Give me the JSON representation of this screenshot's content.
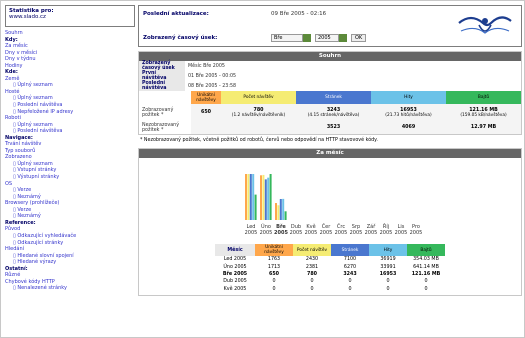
{
  "stats_box": {
    "title": "Statistika pro:",
    "site": "www.slado.cz"
  },
  "sidebar": {
    "items": [
      {
        "type": "lnk",
        "text": "Souhrn"
      },
      {
        "type": "hd",
        "text": "Kdy:"
      },
      {
        "type": "lnk",
        "text": "Za měsíc"
      },
      {
        "type": "lnk",
        "text": "Dny v měsíci"
      },
      {
        "type": "lnk",
        "text": "Dny v týdnu"
      },
      {
        "type": "lnk",
        "text": "Hodiny"
      },
      {
        "type": "hd",
        "text": "Kde:"
      },
      {
        "type": "lnk",
        "text": "Země"
      },
      {
        "type": "sub",
        "text": "▯ Úplný seznam"
      },
      {
        "type": "lnk",
        "text": "Hosté"
      },
      {
        "type": "sub",
        "text": "▯ Úplný seznam"
      },
      {
        "type": "sub",
        "text": "▯ Poslední návštěva"
      },
      {
        "type": "sub",
        "text": "▯ Nepřeložené IP adresy"
      },
      {
        "type": "lnk",
        "text": "Roboti"
      },
      {
        "type": "sub",
        "text": "▯ Úplný seznam"
      },
      {
        "type": "sub",
        "text": "▯ Poslední návštěva"
      },
      {
        "type": "hd",
        "text": "Navigace:"
      },
      {
        "type": "lnk",
        "text": "Trvání návštěv"
      },
      {
        "type": "lnk",
        "text": "Typ souborů"
      },
      {
        "type": "lnk",
        "text": "Zobrazeno"
      },
      {
        "type": "sub",
        "text": "▯ Úplný seznam"
      },
      {
        "type": "sub",
        "text": "▯ Vstupní stránky"
      },
      {
        "type": "sub",
        "text": "▯ Výstupní stránky"
      },
      {
        "type": "lnk",
        "text": "OS"
      },
      {
        "type": "sub",
        "text": "▯ Verze"
      },
      {
        "type": "sub",
        "text": "▯ Neznámý"
      },
      {
        "type": "lnk",
        "text": "Browsery (prohlížeče)"
      },
      {
        "type": "sub",
        "text": "▯ Verze"
      },
      {
        "type": "sub",
        "text": "▯ Neznámý"
      },
      {
        "type": "hd",
        "text": "Reference:"
      },
      {
        "type": "lnk",
        "text": "Původ"
      },
      {
        "type": "sub",
        "text": "▯ Odkazující vyhledávače"
      },
      {
        "type": "sub",
        "text": "▯ Odkazující stránky"
      },
      {
        "type": "lnk",
        "text": "Hledání"
      },
      {
        "type": "sub",
        "text": "▯ Hledané slovní spojení"
      },
      {
        "type": "sub",
        "text": "▯ Hledané výrazy"
      },
      {
        "type": "hd",
        "text": "Ostatní:"
      },
      {
        "type": "lnk",
        "text": "Různé"
      },
      {
        "type": "lnk",
        "text": "Chybové kódy HTTP"
      },
      {
        "type": "sub",
        "text": "▯ Nenalezené stránky"
      }
    ]
  },
  "header": {
    "last_update_label": "Poslední aktualizace:",
    "last_update_value": "09 Bře 2005 - 02:16",
    "period_label": "Zobrazený časový úsek:",
    "month_value": "Bře",
    "year_value": "2005",
    "ok_label": "OK"
  },
  "summary": {
    "title": "Souhrn",
    "period_label": "Zobrazený časový úsek",
    "period_value": "Měsíc Bře 2005",
    "first_visit_label": "První návštěva",
    "first_visit_value": "01 Bře 2005 - 00:05",
    "last_visit_label": "Poslední návštěva",
    "last_visit_value": "08 Bře 2005 - 23:58",
    "col_unique": "Unikátní návštěvy",
    "col_visits": "Počet návštěv",
    "col_pages": "Stránek",
    "col_hits": "Hity",
    "col_bytes": "Bajtů",
    "viewed_label": "Zobrazovaný požitek *",
    "viewed_unique": "650",
    "viewed_visits": "780",
    "viewed_visits_sub": "(1.2 návštěv/návštěvník)",
    "viewed_pages": "3243",
    "viewed_pages_sub": "(4.15 stránek/návštěva)",
    "viewed_hits": "16953",
    "viewed_hits_sub": "(21.73 hitů/návštěva)",
    "viewed_bytes": "121.16 MB",
    "viewed_bytes_sub": "(159.05 kB/návštěva)",
    "unviewed_label": "Nezobrazovaný požitek *",
    "unviewed_pages": "3523",
    "unviewed_hits": "4069",
    "unviewed_bytes": "12.97 MB",
    "note": "* Nezobrazovaný požitek, včetně požitků od robotů, červů nebo odpovědí na HTTP stavovové kódy."
  },
  "monthly": {
    "title": "Za měsíc",
    "col_month": "Měsíc",
    "col_unique": "Unikátní návštěvy",
    "col_visits": "Počet návštěv",
    "col_pages": "Stránek",
    "col_hits": "Hity",
    "col_bytes": "Bajtů",
    "rows": [
      {
        "m": "Led 2005",
        "u": "1763",
        "v": "2430",
        "p": "7100",
        "h": "36919",
        "b": "354.03 MB",
        "bold": false
      },
      {
        "m": "Úno 2005",
        "u": "1713",
        "v": "2381",
        "p": "6270",
        "h": "33991",
        "b": "641.14 MB",
        "bold": false
      },
      {
        "m": "Bře 2005",
        "u": "650",
        "v": "780",
        "p": "3243",
        "h": "16953",
        "b": "121.16 MB",
        "bold": true
      },
      {
        "m": "Dub 2005",
        "u": "0",
        "v": "0",
        "p": "0",
        "h": "0",
        "b": "0",
        "bold": false
      },
      {
        "m": "Kvě 2005",
        "u": "0",
        "v": "0",
        "p": "0",
        "h": "0",
        "b": "0",
        "bold": false
      }
    ]
  },
  "chart_data": {
    "type": "bar",
    "categories": [
      "Led 2005",
      "Úno 2005",
      "Bře 2005",
      "Dub 2005",
      "Kvě 2005",
      "Čer 2005",
      "Črc 2005",
      "Srp 2005",
      "Zář 2005",
      "Říj 2005",
      "Lis 2005",
      "Pro 2005"
    ],
    "series": [
      {
        "name": "Unikátní návštěvy",
        "values": [
          1763,
          1713,
          650,
          0,
          0,
          0,
          0,
          0,
          0,
          0,
          0,
          0
        ],
        "color": "#ffa74b"
      },
      {
        "name": "Počet návštěv",
        "values": [
          2430,
          2381,
          780,
          0,
          0,
          0,
          0,
          0,
          0,
          0,
          0,
          0
        ],
        "color": "#f5ec73"
      },
      {
        "name": "Stránek",
        "values": [
          7100,
          6270,
          3243,
          0,
          0,
          0,
          0,
          0,
          0,
          0,
          0,
          0
        ],
        "color": "#4a77cf"
      },
      {
        "name": "Hity",
        "values": [
          36919,
          33991,
          16953,
          0,
          0,
          0,
          0,
          0,
          0,
          0,
          0,
          0
        ],
        "color": "#6cc2e8"
      },
      {
        "name": "Bajtů (MB)",
        "values": [
          354.03,
          641.14,
          121.16,
          0,
          0,
          0,
          0,
          0,
          0,
          0,
          0,
          0
        ],
        "color": "#35b85c"
      }
    ]
  }
}
